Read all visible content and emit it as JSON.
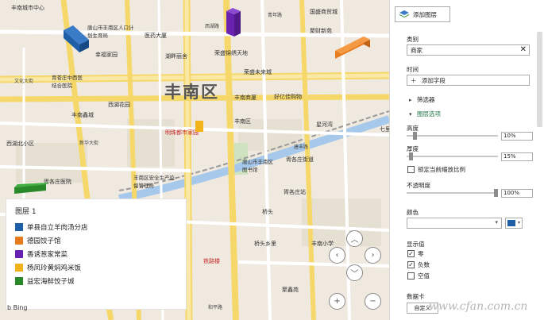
{
  "map": {
    "district": "丰南区",
    "labels": {
      "l1": "丰南城市中心",
      "l2": "唐山市丰南区人口计划生育局",
      "l3": "文化大街",
      "l4": "育苍庄中西医结合医院",
      "l5": "医药大厦",
      "l6": "湖畔丽舍",
      "l7": "荣盛锦绣天地",
      "l8": "荣盛未来城",
      "l9": "丰南商厦",
      "l10": "好亿佳购物",
      "l11": "明珠都市家园",
      "l12": "星河湾",
      "l13": "唐山市丰南区图书馆",
      "l14": "丰南区安全生产监督管理局",
      "l15": "丰南区",
      "l16": "西湖路",
      "l17": "国盛商贸城",
      "l18": "聚财新苑",
      "l19": "青年路",
      "l20": "桥头",
      "l21": "胥各庄站",
      "l22": "桥头乡里",
      "l23": "丰南小学",
      "l24": "铁路楼",
      "l25": "胥各庄医院",
      "l26": "新华大街",
      "l27": "胥各庄街道",
      "l28": "西湖花园",
      "l29": "幸福家园",
      "l30": "丰南鑫城",
      "l31": "西湖北小区",
      "l32": "唐丰路",
      "l33": "七里",
      "l34": "和平路",
      "l35": "聚鑫苑"
    }
  },
  "legend": {
    "title": "图层 1",
    "items": [
      {
        "label": "单县自立羊肉汤分店",
        "color": "#1f5fa8"
      },
      {
        "label": "德园饺子馆",
        "color": "#e87b1e"
      },
      {
        "label": "香诱葱家常菜",
        "color": "#6a22b0"
      },
      {
        "label": "杨凤玲黄焖鸡米饭",
        "color": "#f2b21a"
      },
      {
        "label": "益宏海鲜饺子城",
        "color": "#2a8a2a"
      }
    ],
    "attribution": "b Bing"
  },
  "pane": {
    "add_layer": "添加图层",
    "category_label": "类别",
    "category_value": "商家",
    "time_label": "时间",
    "add_field": "添加字段",
    "filter_label": "筛选器",
    "layer_options": "图层选项",
    "height_label": "高度",
    "height_value": "10%",
    "thickness_label": "厚度",
    "thickness_value": "15%",
    "lock_label": "锁定当前缩放比例",
    "opacity_label": "不透明度",
    "opacity_value": "100%",
    "color_label": "颜色",
    "color_value": "#1f5fa8",
    "show_values_label": "显示值",
    "zero_label": "零",
    "negative_label": "负数",
    "null_label": "空值",
    "data_card_label": "数据卡",
    "custom_label": "自定义"
  },
  "watermark": "www.cfan.com.cn"
}
